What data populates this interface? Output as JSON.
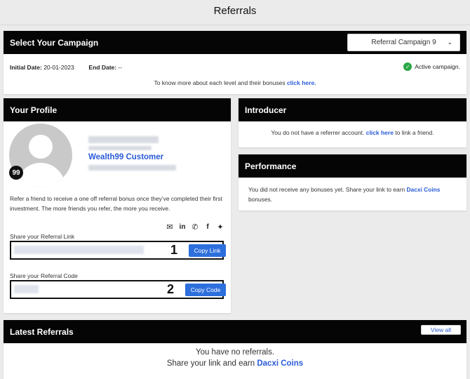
{
  "page": {
    "title": "Referrals"
  },
  "campaign": {
    "header": "Select Your Campaign",
    "selected": "Referral Campaign 9",
    "initial_date_label": "Initial Date:",
    "initial_date": "20-01-2023",
    "end_date_label": "End Date:",
    "end_date": "--",
    "status": "Active campaign.",
    "levels_text": "To know more about each level and their bonuses",
    "levels_link": "click here."
  },
  "profile": {
    "header": "Your Profile",
    "logo_text": "99",
    "customer_name": "Wealth99 Customer",
    "refer_text": "Refer a friend to receive a one off referral bonus once they’ve completed their first investment. The more friends you refer, the more you receive.",
    "share_icons": [
      "envelope-icon",
      "linkedin-icon",
      "whatsapp-icon",
      "facebook-icon",
      "twitter-icon"
    ],
    "link_label": "Share your Referral Link",
    "link_marker": "1",
    "copy_link_label": "Copy Link",
    "code_label": "Share your Referral Code",
    "code_marker": "2",
    "copy_code_label": "Copy Code"
  },
  "introducer": {
    "header": "Introducer",
    "text": "You do not have a referrer account.",
    "link": "click here",
    "text_after": "to link a friend."
  },
  "performance": {
    "header": "Performance",
    "text": "You did not receive any bonuses yet. Share your link to earn",
    "link": "Dacxi Coins",
    "text_after": "bonuses."
  },
  "latest": {
    "header": "Latest Referrals",
    "view_all": "View all",
    "empty_line1": "You have no referrals.",
    "empty_line2": "Share your link and earn",
    "empty_link": "Dacxi Coins"
  },
  "colors": {
    "accent": "#2a5bd7",
    "button": "#2d6fdc",
    "header_bg": "#050505",
    "active_green": "#29a745"
  }
}
